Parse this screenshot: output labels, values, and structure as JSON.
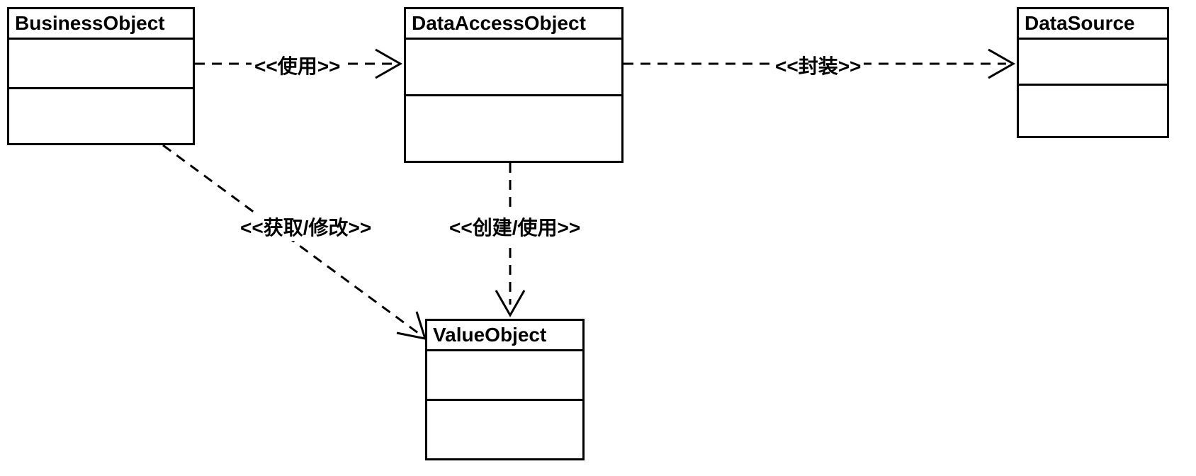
{
  "classes": {
    "businessObject": {
      "name": "BusinessObject"
    },
    "dataAccessObject": {
      "name": "DataAccessObject"
    },
    "dataSource": {
      "name": "DataSource"
    },
    "valueObject": {
      "name": "ValueObject"
    }
  },
  "relations": {
    "boToDao": {
      "stereotype": "<<使用>>"
    },
    "daoToDs": {
      "stereotype": "<<封装>>"
    },
    "daoToVo": {
      "stereotype": "<<创建/使用>>"
    },
    "boToVo": {
      "stereotype": "<<获取/修改>>"
    }
  }
}
